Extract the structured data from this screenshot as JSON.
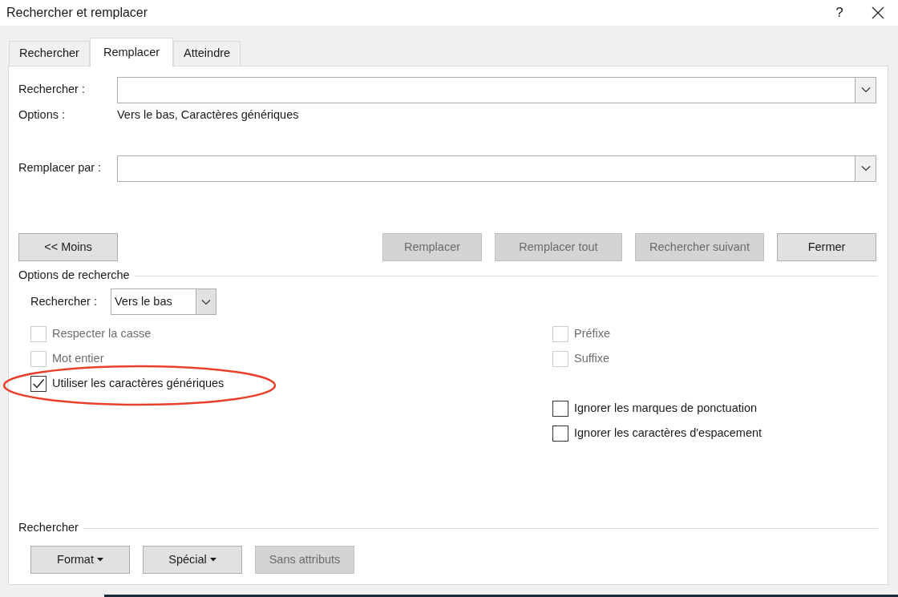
{
  "window": {
    "title": "Rechercher et remplacer",
    "help": "?"
  },
  "tabs": [
    {
      "label": "Rechercher",
      "selected": false
    },
    {
      "label": "Remplacer",
      "selected": true
    },
    {
      "label": "Atteindre",
      "selected": false
    }
  ],
  "find": {
    "label": "Rechercher :"
  },
  "options": {
    "label": "Options :",
    "value": "Vers le bas, Caractères génériques"
  },
  "replace": {
    "label": "Remplacer par :"
  },
  "buttons": [
    {
      "label": "<< Moins",
      "disabled": false
    },
    {
      "label": "Remplacer",
      "disabled": true
    },
    {
      "label": "Remplacer tout",
      "disabled": true
    },
    {
      "label": "Rechercher suivant",
      "disabled": true
    },
    {
      "label": "Fermer",
      "disabled": false
    }
  ],
  "search_options": {
    "title": "Options de recherche",
    "direction_label": "Rechercher :",
    "direction_value": "Vers le bas",
    "left": [
      {
        "label": "Respecter la casse",
        "checked": false,
        "disabled": true
      },
      {
        "label": "Mot entier",
        "checked": false,
        "disabled": true
      },
      {
        "label": "Utiliser les caractères génériques",
        "checked": true,
        "disabled": false
      }
    ],
    "right_groups": [
      [
        {
          "label": "Préfixe",
          "checked": false,
          "disabled": true
        },
        {
          "label": "Suffixe",
          "checked": false,
          "disabled": true
        }
      ],
      [
        {
          "label": "Ignorer les marques de ponctuation",
          "checked": false,
          "disabled": false
        },
        {
          "label": "Ignorer les caractères d'espacement",
          "checked": false,
          "disabled": false
        }
      ]
    ]
  },
  "find_section": {
    "title": "Rechercher",
    "buttons": [
      {
        "label": "Format",
        "dropdown": true,
        "disabled": false
      },
      {
        "label": "Spécial",
        "dropdown": true,
        "disabled": false
      },
      {
        "label": "Sans attributs",
        "dropdown": false,
        "disabled": true
      }
    ]
  }
}
